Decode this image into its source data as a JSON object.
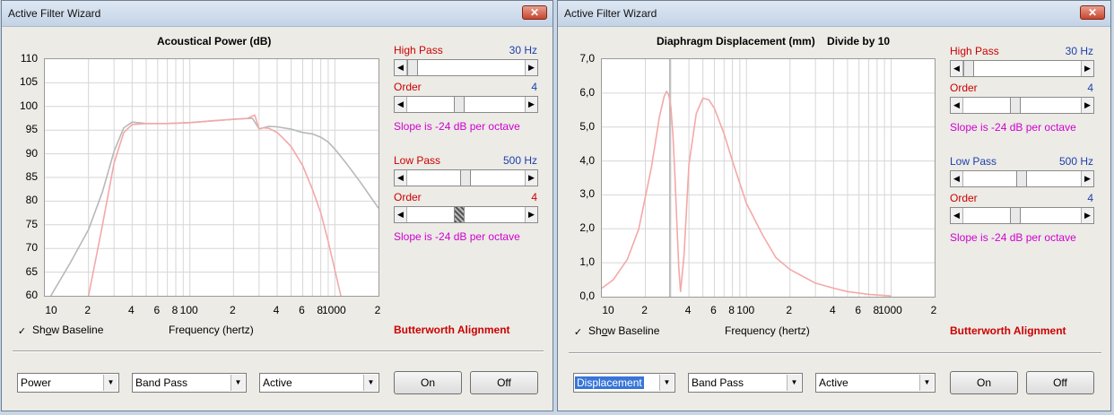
{
  "left": {
    "window_title": "Active Filter Wizard",
    "close_symbol": "✕",
    "chart_title": "Acoustical Power (dB)",
    "high_pass": {
      "label": "High Pass",
      "value": "30 Hz",
      "order_label": "Order",
      "order_value": "4",
      "slope": "Slope is -24 dB per octave"
    },
    "low_pass": {
      "label": "Low Pass",
      "value": "500 Hz",
      "order_label": "Order",
      "order_value": "4",
      "slope": "Slope is -24 dB per octave"
    },
    "show_baseline": {
      "prefix": "Sh",
      "accel": "o",
      "rest": "w Baseline",
      "check": "✓"
    },
    "x_axis_label": "Frequency (hertz)",
    "alignment": "Butterworth Alignment",
    "combos": {
      "mode": "Power",
      "filter_type": "Band Pass",
      "circuit": "Active"
    },
    "buttons": {
      "on": "On",
      "off": "Off"
    }
  },
  "right": {
    "window_title": "Active Filter Wizard",
    "close_symbol": "✕",
    "chart_title": "Diaphragm Displacement (mm)    Divide by 10",
    "high_pass": {
      "label": "High Pass",
      "value": "30 Hz",
      "order_label": "Order",
      "order_value": "4",
      "slope": "Slope is -24 dB per octave"
    },
    "low_pass": {
      "label": "Low Pass",
      "value": "500 Hz",
      "order_label": "Order",
      "order_value": "4",
      "slope": "Slope is -24 dB per octave"
    },
    "show_baseline": {
      "prefix": "Sh",
      "accel": "o",
      "rest": "w Baseline",
      "check": "✓"
    },
    "x_axis_label": "Frequency (hertz)",
    "alignment": "Butterworth Alignment",
    "combos": {
      "mode": "Displacement",
      "filter_type": "Band Pass",
      "circuit": "Active"
    },
    "buttons": {
      "on": "On",
      "off": "Off"
    }
  },
  "chart_data": [
    {
      "type": "line",
      "title": "Acoustical Power (dB)",
      "xlabel": "Frequency (hertz)",
      "ylabel": "",
      "x_scale": "log",
      "xlim": [
        10,
        2000
      ],
      "ylim": [
        60,
        110
      ],
      "y_ticks": [
        "110",
        "105",
        "100",
        "95",
        "90",
        "85",
        "80",
        "75",
        "70",
        "65",
        "60"
      ],
      "x_ticks": [
        {
          "v": 10,
          "t": "10"
        },
        {
          "v": 20,
          "t": "2"
        },
        {
          "v": 40,
          "t": "4"
        },
        {
          "v": 60,
          "t": "6"
        },
        {
          "v": 80,
          "t": "8"
        },
        {
          "v": 100,
          "t": "100"
        },
        {
          "v": 200,
          "t": "2"
        },
        {
          "v": 400,
          "t": "4"
        },
        {
          "v": 600,
          "t": "6"
        },
        {
          "v": 800,
          "t": "8"
        },
        {
          "v": 1000,
          "t": "1000"
        },
        {
          "v": 2000,
          "t": "2"
        }
      ],
      "grid": true,
      "series": [
        {
          "color": "#b8b8b8",
          "x": [
            11,
            15,
            20,
            25,
            30,
            35,
            40,
            50,
            70,
            100,
            150,
            200,
            270,
            300,
            320,
            350,
            400,
            500,
            600,
            700,
            800,
            900,
            1000,
            1200,
            1500,
            2000
          ],
          "y": [
            60,
            67,
            74,
            82,
            90.5,
            95.5,
            96.7,
            96.4,
            96.4,
            96.6,
            97,
            97.3,
            97.5,
            95.3,
            95.5,
            95.8,
            95.7,
            95.2,
            94.5,
            94.2,
            93.5,
            92.5,
            91,
            88,
            84,
            78.5
          ]
        },
        {
          "color": "#f4a8a8",
          "x": [
            20,
            25,
            30,
            35,
            40,
            50,
            70,
            100,
            150,
            200,
            250,
            280,
            300,
            320,
            350,
            400,
            450,
            500,
            600,
            700,
            800,
            900,
            1000,
            1100
          ],
          "y": [
            60,
            75,
            88,
            94.5,
            96.2,
            96.4,
            96.4,
            96.6,
            97,
            97.3,
            97.5,
            98.2,
            95.2,
            95.5,
            95.4,
            94.5,
            93,
            91.5,
            87.5,
            82.5,
            77.5,
            71.5,
            65.5,
            60
          ]
        }
      ]
    },
    {
      "type": "line",
      "title": "Diaphragm Displacement (mm)    Divide by 10",
      "xlabel": "Frequency (hertz)",
      "ylabel": "",
      "x_scale": "log",
      "xlim": [
        10,
        2000
      ],
      "ylim": [
        0,
        7
      ],
      "y_ticks": [
        "7,0",
        "6,0",
        "5,0",
        "4,0",
        "3,0",
        "2,0",
        "1,0",
        "0,0"
      ],
      "x_ticks": [
        {
          "v": 10,
          "t": "10"
        },
        {
          "v": 20,
          "t": "2"
        },
        {
          "v": 40,
          "t": "4"
        },
        {
          "v": 60,
          "t": "6"
        },
        {
          "v": 80,
          "t": "8"
        },
        {
          "v": 100,
          "t": "100"
        },
        {
          "v": 200,
          "t": "2"
        },
        {
          "v": 400,
          "t": "4"
        },
        {
          "v": 600,
          "t": "6"
        },
        {
          "v": 800,
          "t": "8"
        },
        {
          "v": 1000,
          "t": "1000"
        },
        {
          "v": 2000,
          "t": "2"
        }
      ],
      "grid": true,
      "series": [
        {
          "color": "#b8b8b8",
          "x": [
            29.5,
            29.5
          ],
          "y": [
            7,
            0
          ]
        },
        {
          "color": "#f4a8a8",
          "x": [
            10,
            12,
            15,
            18,
            22,
            25,
            27,
            28,
            29,
            30,
            31,
            32,
            33,
            34,
            35,
            37,
            40,
            45,
            50,
            55,
            60,
            70,
            80,
            100,
            130,
            160,
            200,
            300,
            400,
            500,
            700,
            1000
          ],
          "y": [
            0.25,
            0.5,
            1.1,
            2.0,
            3.8,
            5.3,
            5.9,
            6.05,
            5.95,
            5.6,
            4.8,
            3.6,
            2.2,
            0.9,
            0.15,
            1.2,
            3.9,
            5.4,
            5.85,
            5.8,
            5.55,
            4.8,
            4.0,
            2.75,
            1.8,
            1.15,
            0.8,
            0.4,
            0.25,
            0.15,
            0.07,
            0.02
          ]
        }
      ]
    }
  ]
}
